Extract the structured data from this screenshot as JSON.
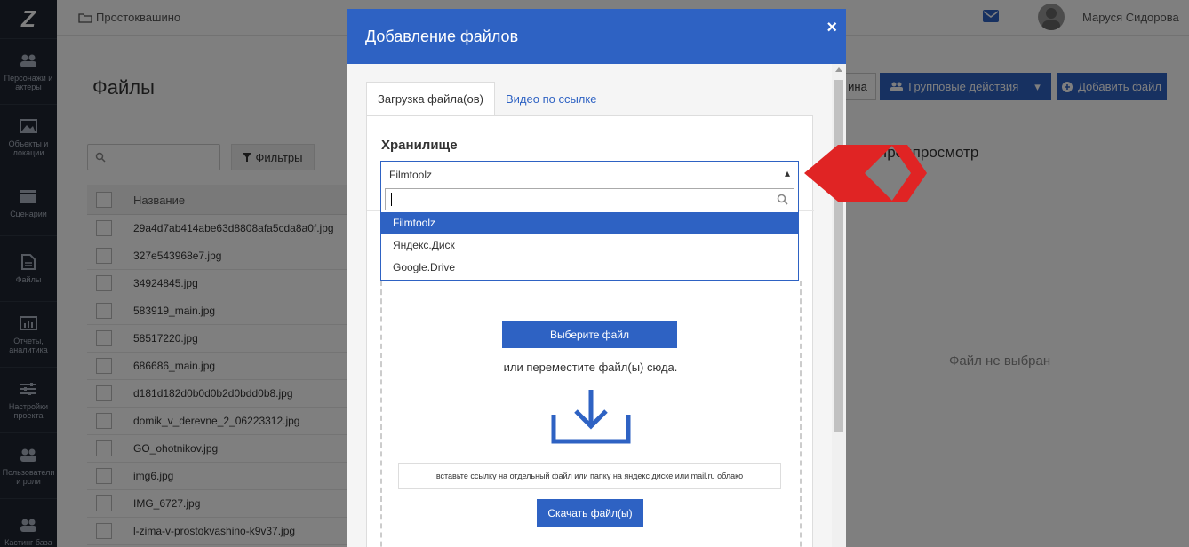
{
  "sidebar": {
    "logo": "Z",
    "items": [
      {
        "label": "Персонажи и актеры",
        "icon": "people-icon"
      },
      {
        "label": "Объекты и локации",
        "icon": "image-icon"
      },
      {
        "label": "Сценарии",
        "icon": "clapper-icon"
      },
      {
        "label": "Файлы",
        "icon": "file-icon"
      },
      {
        "label": "Отчеты, аналитика",
        "icon": "chart-icon"
      },
      {
        "label": "Настройки проекта",
        "icon": "sliders-icon"
      },
      {
        "label": "Пользователи и роли",
        "icon": "users-icon"
      },
      {
        "label": "Кастинг база",
        "icon": "people-icon"
      }
    ]
  },
  "topbar": {
    "breadcrumb": "Простоквашино",
    "user_name": "Маруся Сидорова"
  },
  "page": {
    "title": "Файлы",
    "filters_label": "Фильтры",
    "column_name": "Название",
    "files": [
      "29a4d7ab414abe63d8808afa5cda8a0f.jpg",
      "327e543968e7.jpg",
      "34924845.jpg",
      "583919_main.jpg",
      "58517220.jpg",
      "686686_main.jpg",
      "d181d182d0b0d0b2d0bdd0b8.jpg",
      "domik_v_derevne_2_06223312.jpg",
      "GO_ohotnikov.jpg",
      "img6.jpg",
      "IMG_6727.jpg",
      "l-zima-v-prostokvashino-k9v37.jpg"
    ],
    "btn_partial": "ина",
    "btn_group": "Групповые действия",
    "btn_add": "Добавить файл",
    "preview_title": "Предпросмотр",
    "no_file": "Файл не выбран"
  },
  "modal": {
    "title": "Добавление файлов",
    "close": "×",
    "tabs": [
      "Загрузка файла(ов)",
      "Видео по ссылке"
    ],
    "storage_label": "Хранилище",
    "storage_value": "Filmtoolz",
    "storage_options": [
      "Filmtoolz",
      "Яндекс.Диск",
      "Google.Drive"
    ],
    "choose_file": "Выберите файл",
    "drop_text": "или переместите файл(ы) сюда.",
    "url_placeholder": "вставьте ссылку на отдельный файл или папку на яндекс диске или mail.ru облако",
    "download_btn": "Скачать файл(ы)"
  },
  "colors": {
    "accent": "#2e62c3",
    "sidebar": "#1f2530",
    "arrow": "#e02424"
  }
}
